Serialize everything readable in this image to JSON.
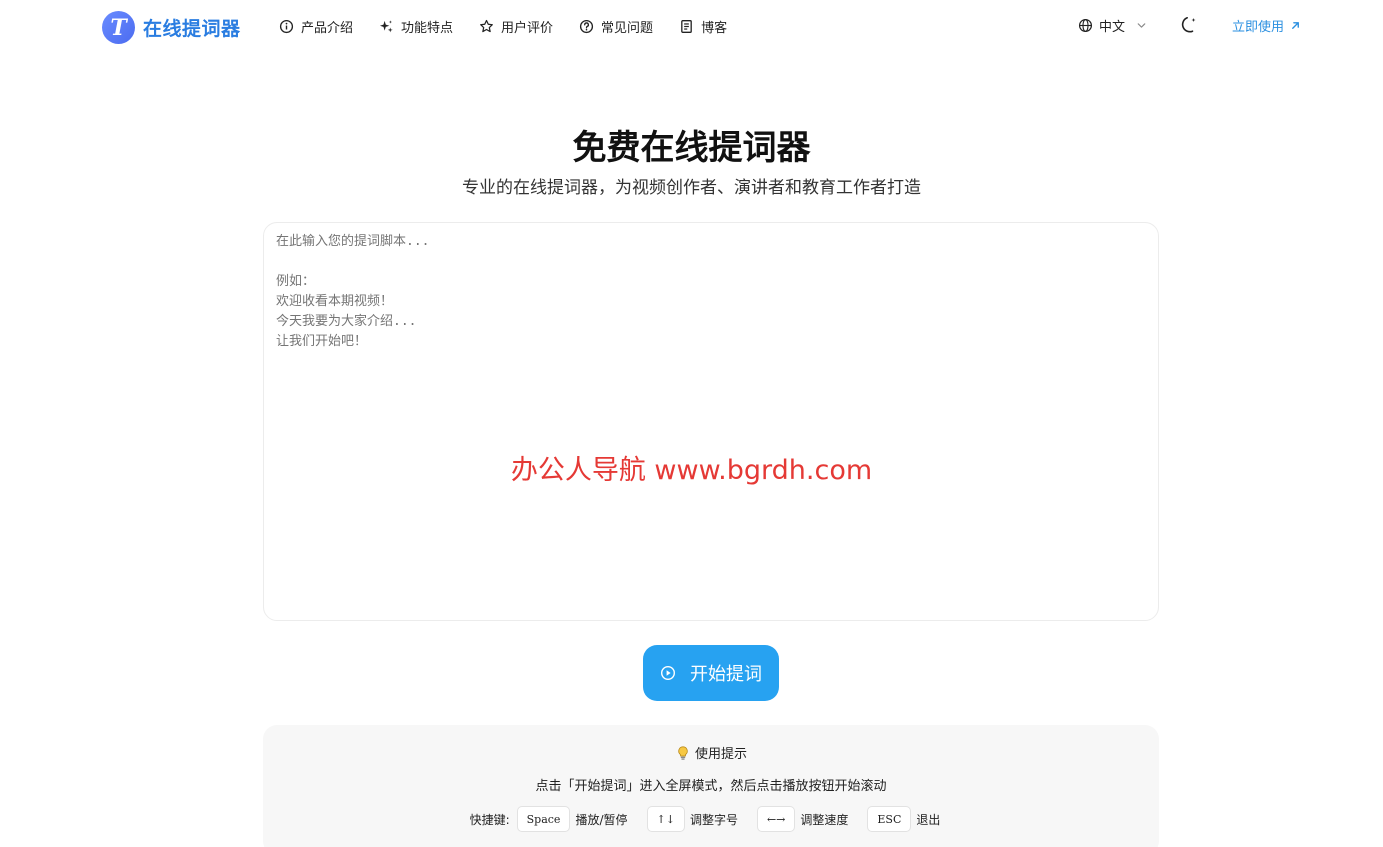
{
  "header": {
    "logo_text": "在线提词器",
    "nav": [
      {
        "label": "产品介绍",
        "icon": "info-icon"
      },
      {
        "label": "功能特点",
        "icon": "sparkle-icon"
      },
      {
        "label": "用户评价",
        "icon": "star-icon"
      },
      {
        "label": "常见问题",
        "icon": "question-icon"
      },
      {
        "label": "博客",
        "icon": "document-icon"
      }
    ],
    "language": "中文",
    "cta_label": "立即使用"
  },
  "hero": {
    "title": "免费在线提词器",
    "subtitle": "专业的在线提词器，为视频创作者、演讲者和教育工作者打造"
  },
  "editor": {
    "placeholder": "在此输入您的提词脚本...\n\n例如：\n欢迎收看本期视频！\n今天我要为大家介绍...\n让我们开始吧！"
  },
  "watermark": "办公人导航 www.bgrdh.com",
  "start_button": {
    "label": "开始提词"
  },
  "tips": {
    "title": "使用提示",
    "description": "点击「开始提词」进入全屏模式，然后点击播放按钮开始滚动",
    "shortcuts_label": "快捷键:",
    "shortcuts": [
      {
        "key": "Space",
        "action": "播放/暂停"
      },
      {
        "key": "↑↓",
        "action": "调整字号"
      },
      {
        "key": "←→",
        "action": "调整速度"
      },
      {
        "key": "ESC",
        "action": "退出"
      }
    ]
  },
  "colors": {
    "brand": "#2a7de1",
    "accent": "#27a2f1",
    "watermark": "#e53935"
  }
}
